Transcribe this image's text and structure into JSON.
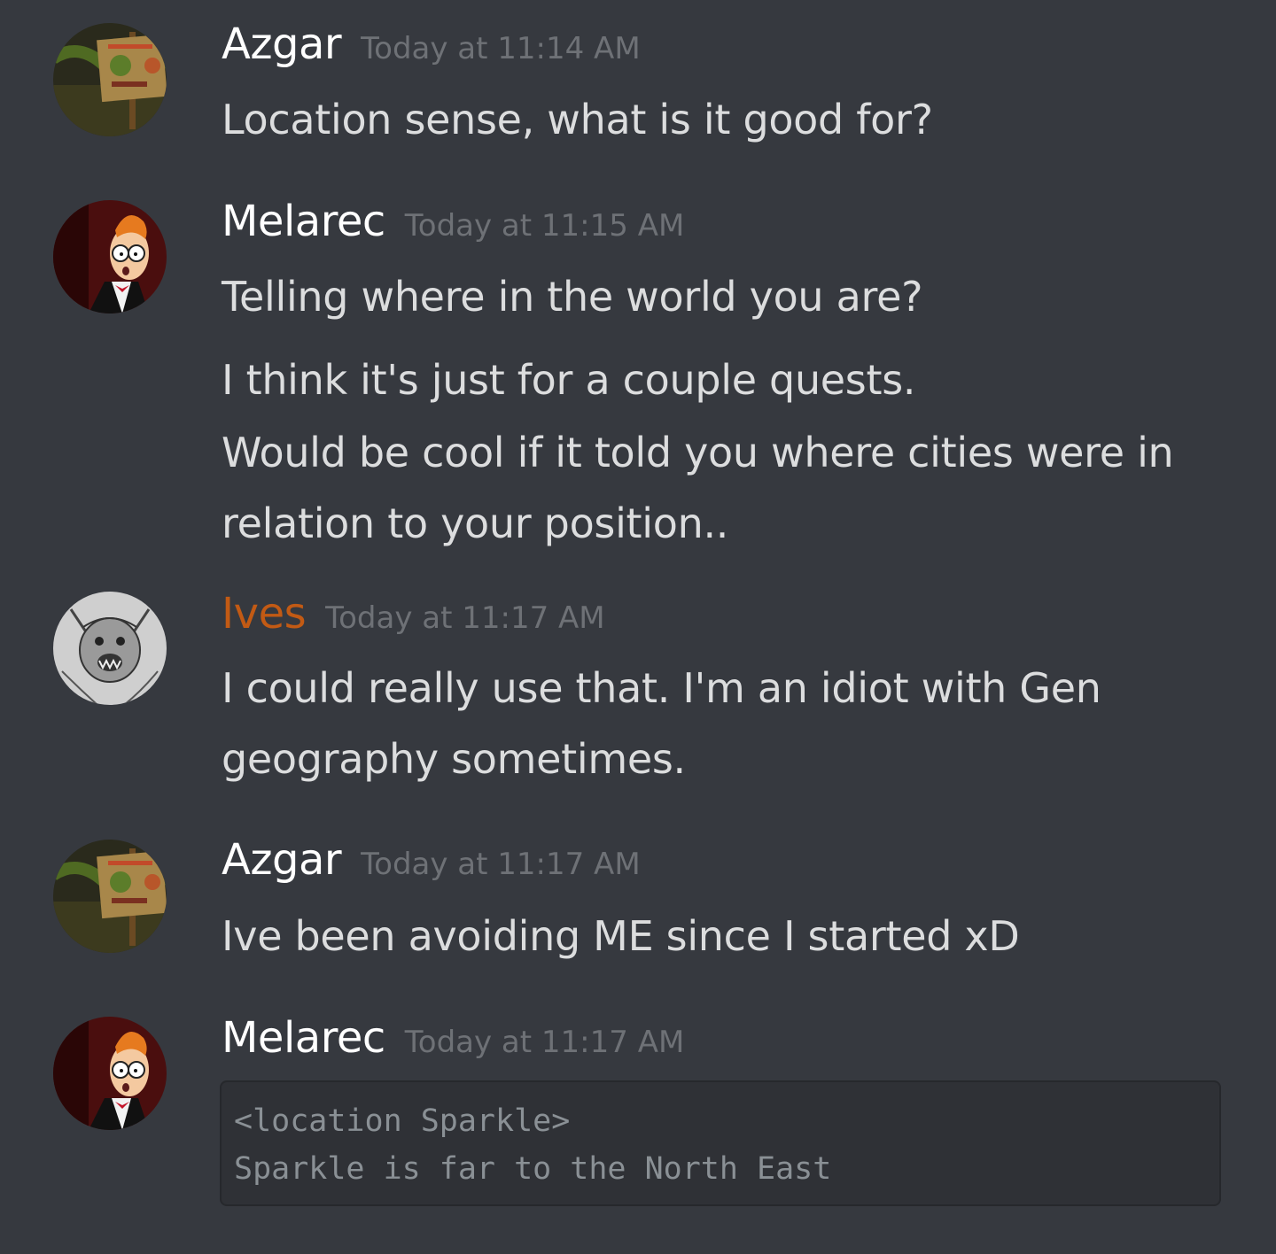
{
  "messages": [
    {
      "username": "Azgar",
      "timestamp": "Today at 11:14 AM",
      "avatar_icon": "ogre-sign-avatar-icon",
      "lines": [
        "Location sense, what is it good for?"
      ]
    },
    {
      "username": "Melarec",
      "timestamp": "Today at 11:15 AM",
      "avatar_icon": "fry-avatar-icon",
      "lines": [
        "Telling where in the world you are?",
        "I think it's just for a couple quests.",
        "Would be cool if it told you where cities were in",
        "relation to your position.."
      ]
    },
    {
      "username": "Ives",
      "username_color": "#c25a14",
      "timestamp": "Today at 11:17 AM",
      "avatar_icon": "sketch-creature-avatar-icon",
      "lines": [
        "I could really use that.  I'm an idiot with Gen",
        "geography sometimes."
      ]
    },
    {
      "username": "Azgar",
      "timestamp": "Today at 11:17 AM",
      "avatar_icon": "ogre-sign-avatar-icon",
      "lines": [
        "Ive been avoiding ME since I started xD"
      ]
    },
    {
      "username": "Melarec",
      "timestamp": "Today at 11:17 AM",
      "avatar_icon": "fry-avatar-icon",
      "code_lines": [
        "<location Sparkle>",
        "Sparkle is far to the North East"
      ]
    }
  ],
  "colors": {
    "background": "#36393f",
    "username": "#ffffff",
    "ives_username": "#c25a14",
    "timestamp": "#6e7176",
    "message_text": "#dcddde",
    "code_background": "#2f3136",
    "code_text": "#8a9095"
  }
}
